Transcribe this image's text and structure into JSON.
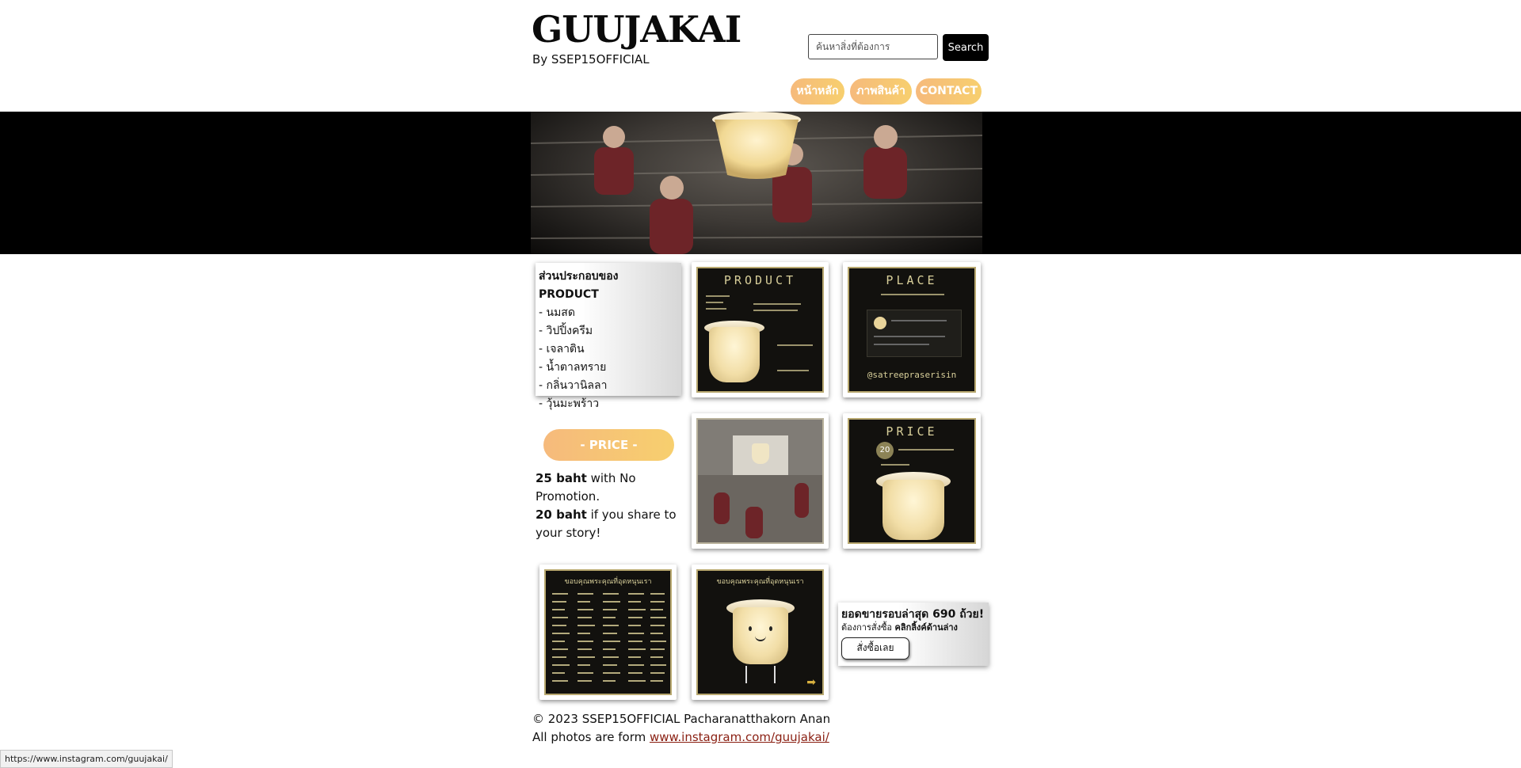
{
  "header": {
    "brand": "GUUJAKAI",
    "byline": "By SSEP15OFFICIAL",
    "search_placeholder": "ค้นหาสิ่งที่ต้องการ",
    "search_button": "Search"
  },
  "nav": [
    "หน้าหลัก",
    "ภาพสินค้า",
    "CONTACT"
  ],
  "ingredients": {
    "title": "ส่วนประกอบของ PRODUCT",
    "items": [
      "- นมสด",
      "- วิปปิ้งครีม",
      "- เจลาติน",
      "- น้ำตาลทราย",
      "- กลิ่นวานิลลา",
      "- วุ้นมะพร้าว"
    ]
  },
  "posters": {
    "product": "PRODUCT",
    "place": "PLACE",
    "place_handle": "@satreepraserisin",
    "price": "PRICE",
    "price_badge": "20",
    "thanks": "ขอบคุณพระคุณที่อุดหนุนเรา"
  },
  "price": {
    "pill": "- PRICE -",
    "line1_bold": "25 baht",
    "line1_rest": " with No Promotion.",
    "line2_bold": "20 baht",
    "line2_rest": " if you share to your story!"
  },
  "sales": {
    "headline": "ยอดขายรอบล่าสุด 690 ถ้วย!",
    "sub_prefix": "ต้องการสั่งซื้อ ",
    "sub_bold": "คลิกลิ้งค์ด้านล่าง",
    "button": "สั่งซื้อเลย"
  },
  "footer": {
    "copyright": "© 2023 SSEP15OFFICIAL Pacharanatthakorn Anan",
    "credit_prefix": "All photos are form ",
    "credit_link": "www.instagram.com/guujakai/"
  },
  "status_bar_url": "https://www.instagram.com/guujakai/"
}
